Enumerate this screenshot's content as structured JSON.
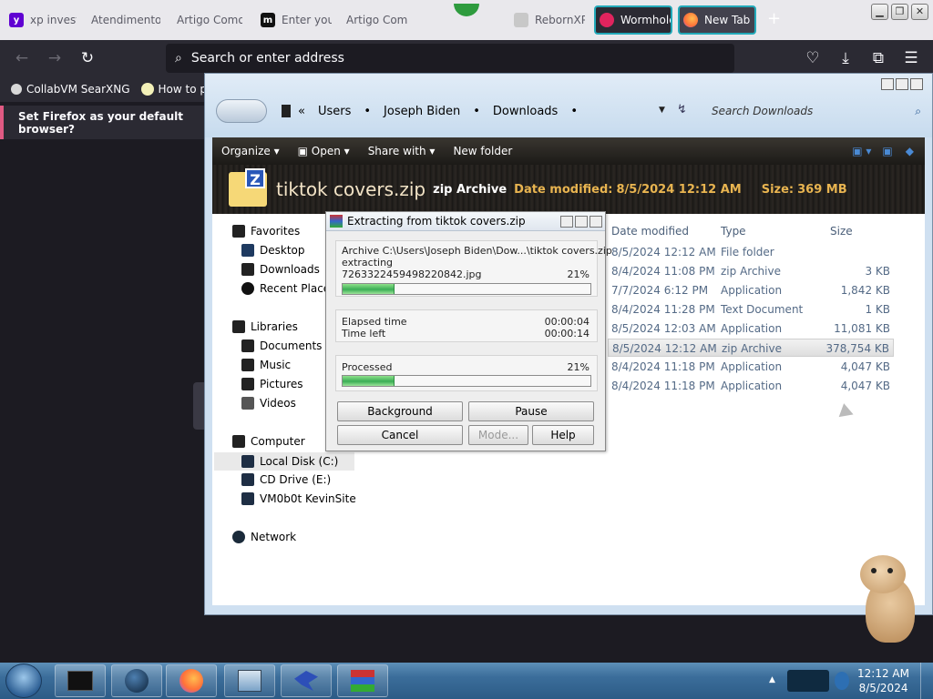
{
  "browser": {
    "tabs": [
      {
        "label": "xp investi",
        "fav": "yahoo-icon",
        "fav_color": "#6001d2"
      },
      {
        "label": "Atendimento"
      },
      {
        "label": "Artigo Como"
      },
      {
        "label": "Enter you",
        "fav": "m-icon",
        "fav_color": "#111111"
      },
      {
        "label": "Artigo Com"
      },
      {
        "label": "RebornXP"
      },
      {
        "label": "Wormhole",
        "fav": "wormhole-icon",
        "fav_color": "#e0245e"
      },
      {
        "label": "New Tab",
        "fav": "firefox-icon",
        "fav_color": "#ff7139"
      }
    ],
    "url_placeholder": "Search or enter address",
    "bookmarks": [
      {
        "label": "CollabVM SearXNG"
      },
      {
        "label": "How to pro"
      }
    ],
    "notification": "Set Firefox as your default browser?"
  },
  "explorer": {
    "breadcrumb": [
      "Users",
      "Joseph Biden",
      "Downloads"
    ],
    "search_placeholder": "Search Downloads",
    "toolbar": {
      "organize": "Organize",
      "open": "Open",
      "share_with": "Share with",
      "new_folder": "New folder"
    },
    "details": {
      "file_name": "tiktok covers.zip",
      "file_type": "zip Archive",
      "date_label": "Date modified:",
      "date_value": "8/5/2024 12:12 AM",
      "size_label": "Size:",
      "size_value": "369 MB"
    },
    "nav": {
      "favorites": "Favorites",
      "desktop": "Desktop",
      "downloads": "Downloads",
      "recent": "Recent Places",
      "libraries": "Libraries",
      "documents": "Documents",
      "music": "Music",
      "pictures": "Pictures",
      "videos": "Videos",
      "computer": "Computer",
      "local_disk": "Local Disk (C:)",
      "cd_drive": "CD Drive (E:)",
      "vm": "VM0b0t KevinSite",
      "network": "Network"
    },
    "columns": {
      "date": "Date modified",
      "type": "Type",
      "size": "Size"
    },
    "rows": [
      {
        "date": "8/5/2024 12:12 AM",
        "type": "File folder",
        "size": ""
      },
      {
        "date": "8/4/2024 11:08 PM",
        "type": "zip Archive",
        "size": "3 KB"
      },
      {
        "date": "7/7/2024 6:12 PM",
        "type": "Application",
        "size": "1,842 KB"
      },
      {
        "date": "8/4/2024 11:28 PM",
        "type": "Text Document",
        "size": "1 KB"
      },
      {
        "date": "8/5/2024 12:03 AM",
        "type": "Application",
        "size": "11,081 KB"
      },
      {
        "date": "8/5/2024 12:12 AM",
        "type": "zip Archive",
        "size": "378,754 KB"
      },
      {
        "date": "8/4/2024 11:18 PM",
        "type": "Application",
        "size": "4,047 KB"
      },
      {
        "date": "8/4/2024 11:18 PM",
        "type": "Application",
        "size": "4,047 KB"
      }
    ]
  },
  "dialog": {
    "title": "Extracting from tiktok covers.zip",
    "archive_line": "Archive C:\\Users\\Joseph Biden\\Dow...\\tiktok covers.zip",
    "action": "extracting",
    "current_file": "7263322459498220842.jpg",
    "file_percent": "21%",
    "file_progress": 0.21,
    "elapsed_label": "Elapsed time",
    "elapsed_value": "00:00:04",
    "left_label": "Time left",
    "left_value": "00:00:14",
    "processed_label": "Processed",
    "processed_percent": "21%",
    "processed_progress": 0.21,
    "buttons": {
      "background": "Background",
      "pause": "Pause",
      "cancel": "Cancel",
      "mode": "Mode...",
      "help": "Help"
    }
  },
  "taskbar": {
    "time": "12:12 AM",
    "date": "8/5/2024"
  }
}
